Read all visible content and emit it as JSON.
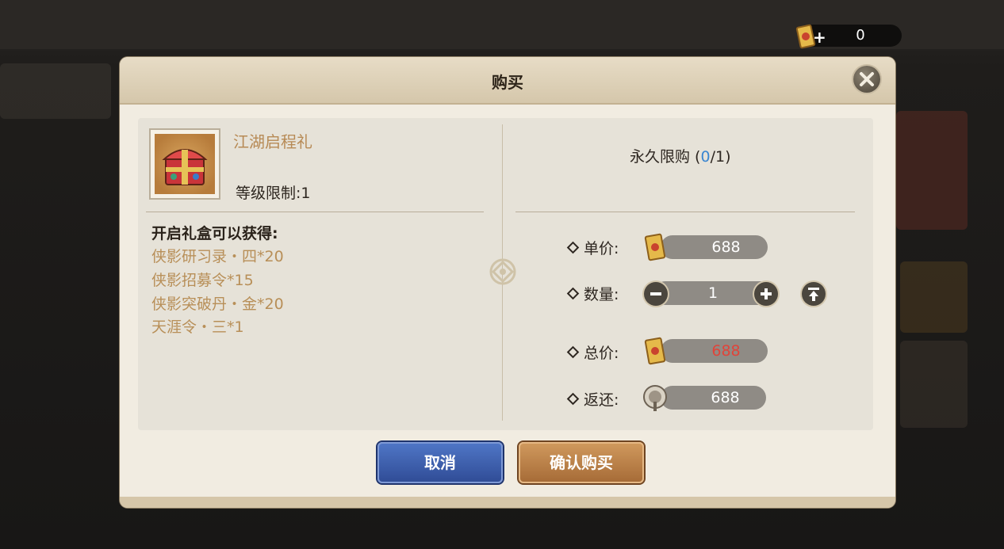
{
  "currency": {
    "amount": "0",
    "plus": "+"
  },
  "dialog": {
    "title": "购买",
    "item": {
      "name": "江湖启程礼",
      "level_limit": "等级限制:1"
    },
    "rewards_title": "开启礼盒可以获得:",
    "rewards": [
      "侠影研习录・四*20",
      "侠影招募令*15",
      "侠影突破丹・金*20",
      "天涯令・三*1"
    ],
    "purchase_limit": {
      "label": "永久限购",
      "current": "0",
      "max": "1"
    },
    "rows": {
      "unit_price_label": "单价:",
      "unit_price": "688",
      "quantity_label": "数量:",
      "quantity": "1",
      "total_label": "总价:",
      "total": "688",
      "refund_label": "返还:",
      "refund": "688"
    },
    "buttons": {
      "cancel": "取消",
      "confirm": "确认购买"
    }
  },
  "colors": {
    "item_name": "#b78a55",
    "reward": "#b88f58",
    "limit_current": "#3a86d1",
    "total_red": "#e0443a"
  },
  "icons": [
    "scroll-currency-icon",
    "close-icon",
    "minus-icon",
    "plus-icon",
    "max-icon",
    "coin-refund-icon",
    "ornament-icon",
    "gift-chest-icon"
  ]
}
